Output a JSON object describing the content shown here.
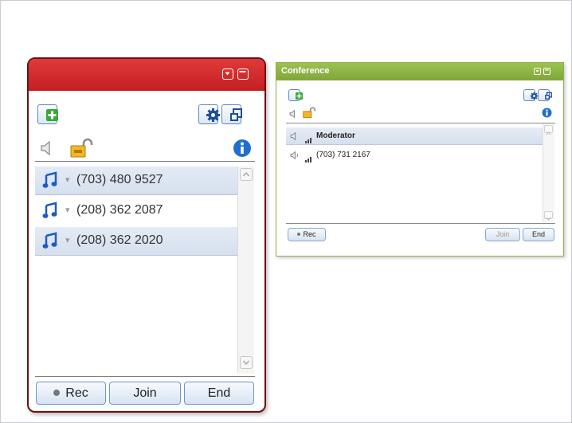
{
  "main_widget": {
    "participants": [
      {
        "number": "(703) 480 9527",
        "highlighted": true
      },
      {
        "number": "(208) 362 2087",
        "highlighted": false
      },
      {
        "number": "(208) 362 2020",
        "highlighted": true
      }
    ],
    "buttons": {
      "rec": "Rec",
      "join": "Join",
      "end": "End"
    },
    "icons": [
      "add-icon",
      "gear-icon",
      "popout-icon",
      "speaker-icon",
      "lock-icon",
      "info-icon",
      "music-note-icon",
      "minimize-icon",
      "maximize-icon"
    ],
    "colors": {
      "titlebar": "#d22a2b",
      "accent": "#1f6fd1"
    }
  },
  "conference_widget": {
    "title": "Conference",
    "participants": [
      {
        "name": "Moderator",
        "bold": true,
        "highlighted": true
      },
      {
        "name": "(703) 731 2167",
        "bold": false,
        "highlighted": false
      }
    ],
    "buttons": {
      "rec": "Rec",
      "join": "Join",
      "end": "End"
    },
    "colors": {
      "titlebar": "#8cb544"
    }
  }
}
